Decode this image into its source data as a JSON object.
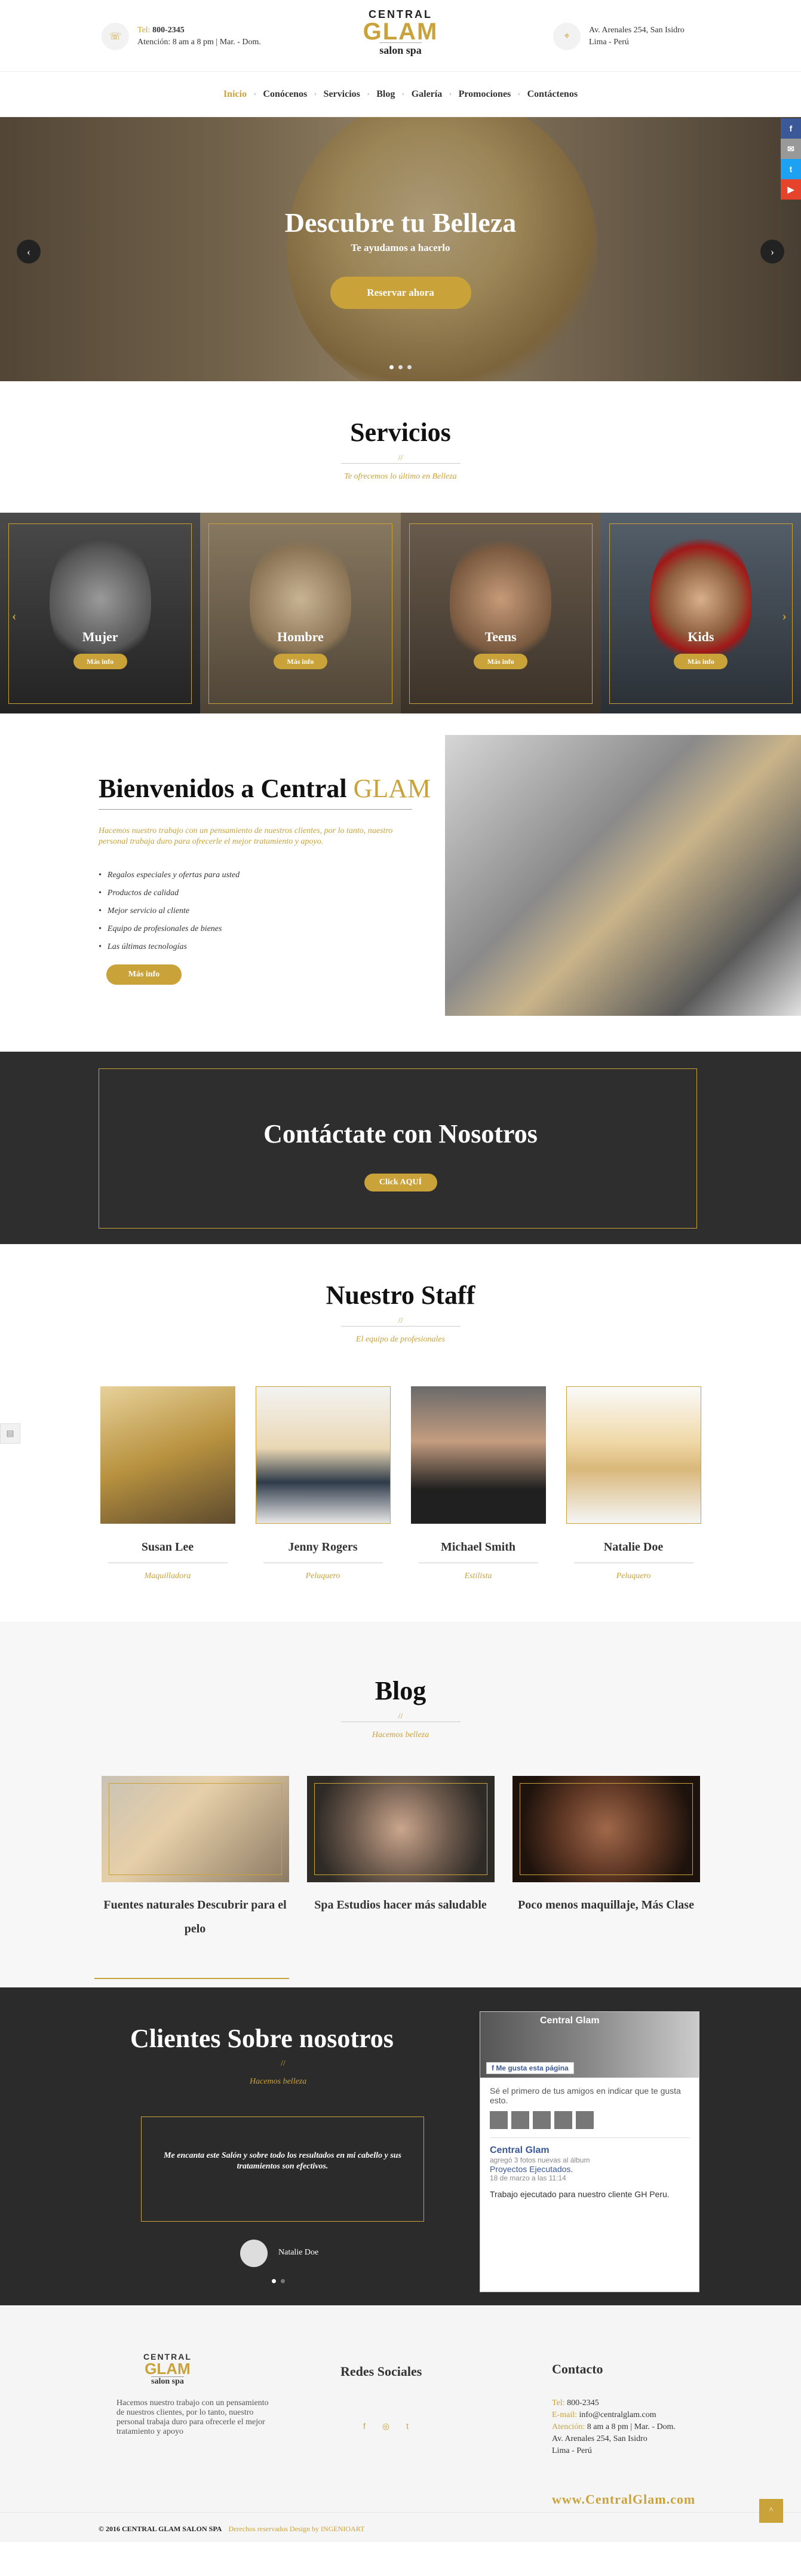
{
  "header": {
    "phone_label": "Tel:",
    "phone": "800-2345",
    "hours": "Atención: 8 am a 8 pm  |  Mar. - Dom.",
    "address_line1": "Av. Arenales  254, San Isidro",
    "address_line2": "Lima - Perú",
    "logo": {
      "line1": "CENTRAL",
      "line2": "GLAM",
      "line3": "salon spa"
    }
  },
  "nav": {
    "items": [
      "Inicio",
      "Conócenos",
      "Servicios",
      "Blog",
      "Galería",
      "Promociones",
      "Contáctenos"
    ],
    "active": "Inicio"
  },
  "social_side": [
    "f",
    "✉",
    "t",
    "▶"
  ],
  "hero": {
    "title": "Descubre tu Belleza",
    "subtitle": "Te ayudamos a hacerlo",
    "button": "Reservar ahora",
    "prev": "‹",
    "next": "›"
  },
  "servicios": {
    "title": "Servicios",
    "slashes": "//",
    "subtitle": "Te ofrecemos lo último en Belleza",
    "items": [
      {
        "name": "Mujer",
        "button": "Más info"
      },
      {
        "name": "Hombre",
        "button": "Más info"
      },
      {
        "name": "Teens",
        "button": "Más info"
      },
      {
        "name": "Kids",
        "button": "Más info"
      }
    ]
  },
  "welcome": {
    "title_main": "Bienvenidos a Central ",
    "title_accent": "GLAM",
    "intro": "Hacemos nuestro trabajo con un pensamiento de nuestros clientes, por lo tanto, nuestro personal trabaja duro para ofrecerle el mejor tratamiento y apoyo.",
    "bullets": [
      "Regalos especiales y ofertas para usted",
      "Productos de calidad",
      "Mejor servicio al cliente",
      "Equipo de profesionales de bienes",
      "Las últimas tecnologías"
    ],
    "button": "Más info"
  },
  "contact_band": {
    "title": "Contáctate con Nosotros",
    "button": "Click AQUÍ"
  },
  "staff": {
    "title": "Nuestro Staff",
    "slashes": "//",
    "subtitle": "El equipo de profesionales",
    "members": [
      {
        "name": "Susan Lee",
        "role": "Maquilladora"
      },
      {
        "name": "Jenny Rogers",
        "role": "Peluquero"
      },
      {
        "name": "Michael Smith",
        "role": "Estilista"
      },
      {
        "name": "Natalie Doe",
        "role": "Peluquero"
      }
    ]
  },
  "blog": {
    "title": "Blog",
    "slashes": "//",
    "subtitle": "Hacemos belleza",
    "posts": [
      {
        "title": "Fuentes naturales Descubrir para el pelo"
      },
      {
        "title": "Spa Estudios hacer más saludable"
      },
      {
        "title": "Poco menos maquillaje, Más Clase"
      }
    ]
  },
  "clients": {
    "title": "Clientes Sobre nosotros",
    "slashes": "//",
    "subtitle": "Hacemos belleza",
    "quote": "Me encanta este Salón y sobre todo los resultados en mi cabello y sus tratamientos son efectivos.",
    "author": "Natalie Doe"
  },
  "facebook": {
    "page_name": "Central Glam",
    "like_button": "Me gusta esta página",
    "friends_text": "Sé el primero de tus amigos en indicar que te gusta esto.",
    "post_author": "Central Glam",
    "post_action": "agregó 3 fotos nuevas al álbum",
    "post_album": "Proyectos Ejecutados.",
    "post_date": "18 de marzo a las 11:14",
    "post_text": "Trabajo ejecutado para nuestro cliente GH Peru."
  },
  "footer": {
    "logo": {
      "line1": "CENTRAL",
      "line2": "GLAM",
      "line3": "salon spa"
    },
    "about": "Hacemos nuestro trabajo con un pensamiento de nuestros clientes, por lo tanto, nuestro personal trabaja duro para ofrecerle el mejor tratamiento y apoyo",
    "social_title": "Redes Sociales",
    "social_icons": [
      "f",
      "◎",
      "t"
    ],
    "contact_title": "Contacto",
    "tel_label": "Tel:",
    "tel": "800-2345",
    "email_label": "E-mail:",
    "email": "info@centralglam.com",
    "hours_label": "Atención:",
    "hours": "8 am a 8 pm  |  Mar. - Dom.",
    "address1": "Av. Arenales  254, San Isidro",
    "address2": "Lima - Perú",
    "url": "www.CentralGlam.com",
    "copyright": "© 2016   CENTRAL GLAM SALON SPA",
    "credits": "Derechos reservados Design by INGENIOART",
    "totop": "^"
  },
  "colors": {
    "gold": "#c9a23a",
    "dark": "#2e2e2e",
    "facebook": "#3b5998",
    "twitter": "#1da1f2",
    "youtube": "#e5432b"
  }
}
